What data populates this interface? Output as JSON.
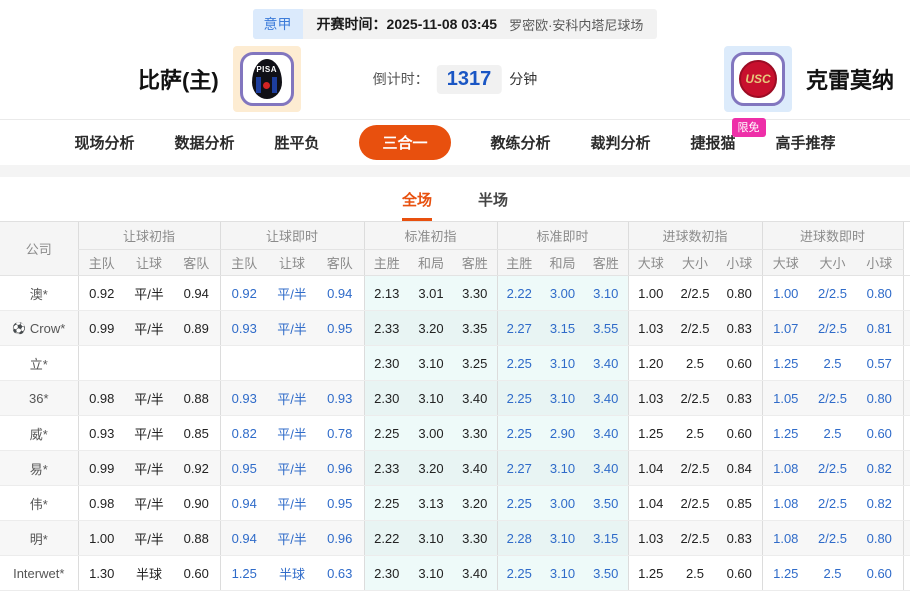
{
  "top": {
    "league": "意甲",
    "kickoff_label": "开赛时间：",
    "kickoff_time": "2025-11-08 03:45",
    "venue": "罗密欧·安科内塔尼球场"
  },
  "teams": {
    "home": "比萨(主)",
    "away": "克雷莫纳",
    "home_logo_text": "PISA",
    "away_logo_text": "USC"
  },
  "countdown": {
    "label": "倒计时：",
    "value": "1317",
    "unit": "分钟"
  },
  "nav": {
    "tabs": [
      {
        "label": "现场分析"
      },
      {
        "label": "数据分析"
      },
      {
        "label": "胜平负"
      },
      {
        "label": "三合一",
        "active": true
      },
      {
        "label": "教练分析"
      },
      {
        "label": "裁判分析"
      },
      {
        "label": "捷报猫",
        "badge": "限免"
      },
      {
        "label": "高手推荐"
      }
    ]
  },
  "subtabs": [
    {
      "label": "全场",
      "active": true
    },
    {
      "label": "半场"
    }
  ],
  "table": {
    "company_header": "公司",
    "groups": [
      {
        "label": "让球初指",
        "cols": [
          "主队",
          "让球",
          "客队"
        ]
      },
      {
        "label": "让球即时",
        "cols": [
          "主队",
          "让球",
          "客队"
        ]
      },
      {
        "label": "标准初指",
        "cols": [
          "主胜",
          "和局",
          "客胜"
        ]
      },
      {
        "label": "标准即时",
        "cols": [
          "主胜",
          "和局",
          "客胜"
        ]
      },
      {
        "label": "进球数初指",
        "cols": [
          "大球",
          "大小",
          "小球"
        ]
      },
      {
        "label": "进球数即时",
        "cols": [
          "大球",
          "大小",
          "小球"
        ]
      }
    ],
    "rows": [
      {
        "company": "澳*",
        "icon": false,
        "cells": [
          [
            "0.92",
            "平/半",
            "0.94"
          ],
          [
            "0.92",
            "平/半",
            "0.94"
          ],
          [
            "2.13",
            "3.01",
            "3.30"
          ],
          [
            "2.22",
            "3.00",
            "3.10"
          ],
          [
            "1.00",
            "2/2.5",
            "0.80"
          ],
          [
            "1.00",
            "2/2.5",
            "0.80"
          ]
        ]
      },
      {
        "company": "Crow*",
        "icon": true,
        "cells": [
          [
            "0.99",
            "平/半",
            "0.89"
          ],
          [
            "0.93",
            "平/半",
            "0.95"
          ],
          [
            "2.33",
            "3.20",
            "3.35"
          ],
          [
            "2.27",
            "3.15",
            "3.55"
          ],
          [
            "1.03",
            "2/2.5",
            "0.83"
          ],
          [
            "1.07",
            "2/2.5",
            "0.81"
          ]
        ]
      },
      {
        "company": "立*",
        "icon": false,
        "cells": [
          [
            "",
            "",
            ""
          ],
          [
            "",
            "",
            ""
          ],
          [
            "2.30",
            "3.10",
            "3.25"
          ],
          [
            "2.25",
            "3.10",
            "3.40"
          ],
          [
            "1.20",
            "2.5",
            "0.60"
          ],
          [
            "1.25",
            "2.5",
            "0.57"
          ]
        ]
      },
      {
        "company": "36*",
        "icon": false,
        "cells": [
          [
            "0.98",
            "平/半",
            "0.88"
          ],
          [
            "0.93",
            "平/半",
            "0.93"
          ],
          [
            "2.30",
            "3.10",
            "3.40"
          ],
          [
            "2.25",
            "3.10",
            "3.40"
          ],
          [
            "1.03",
            "2/2.5",
            "0.83"
          ],
          [
            "1.05",
            "2/2.5",
            "0.80"
          ]
        ]
      },
      {
        "company": "威*",
        "icon": false,
        "cells": [
          [
            "0.93",
            "平/半",
            "0.85"
          ],
          [
            "0.82",
            "平/半",
            "0.78"
          ],
          [
            "2.25",
            "3.00",
            "3.30"
          ],
          [
            "2.25",
            "2.90",
            "3.40"
          ],
          [
            "1.25",
            "2.5",
            "0.60"
          ],
          [
            "1.25",
            "2.5",
            "0.60"
          ]
        ]
      },
      {
        "company": "易*",
        "icon": false,
        "cells": [
          [
            "0.99",
            "平/半",
            "0.92"
          ],
          [
            "0.95",
            "平/半",
            "0.96"
          ],
          [
            "2.33",
            "3.20",
            "3.40"
          ],
          [
            "2.27",
            "3.10",
            "3.40"
          ],
          [
            "1.04",
            "2/2.5",
            "0.84"
          ],
          [
            "1.08",
            "2/2.5",
            "0.82"
          ]
        ]
      },
      {
        "company": "伟*",
        "icon": false,
        "cells": [
          [
            "0.98",
            "平/半",
            "0.90"
          ],
          [
            "0.94",
            "平/半",
            "0.95"
          ],
          [
            "2.25",
            "3.13",
            "3.20"
          ],
          [
            "2.25",
            "3.00",
            "3.50"
          ],
          [
            "1.04",
            "2/2.5",
            "0.85"
          ],
          [
            "1.08",
            "2/2.5",
            "0.82"
          ]
        ]
      },
      {
        "company": "明*",
        "icon": false,
        "cells": [
          [
            "1.00",
            "平/半",
            "0.88"
          ],
          [
            "0.94",
            "平/半",
            "0.96"
          ],
          [
            "2.22",
            "3.10",
            "3.30"
          ],
          [
            "2.28",
            "3.10",
            "3.15"
          ],
          [
            "1.03",
            "2/2.5",
            "0.83"
          ],
          [
            "1.08",
            "2/2.5",
            "0.80"
          ]
        ]
      },
      {
        "company": "Interwet*",
        "icon": false,
        "cells": [
          [
            "1.30",
            "半球",
            "0.60"
          ],
          [
            "1.25",
            "半球",
            "0.63"
          ],
          [
            "2.30",
            "3.10",
            "3.40"
          ],
          [
            "2.25",
            "3.10",
            "3.50"
          ],
          [
            "1.25",
            "2.5",
            "0.60"
          ],
          [
            "1.25",
            "2.5",
            "0.60"
          ]
        ]
      }
    ]
  },
  "colors": {
    "accent_orange": "#e8500e",
    "live_odds_blue": "#2f6bc9",
    "countdown_blue": "#1a56c4",
    "badge_pink": "#ee2fa8",
    "league_badge_blue": "#3d7cd9",
    "std_column_bg": "#eefaf9"
  }
}
